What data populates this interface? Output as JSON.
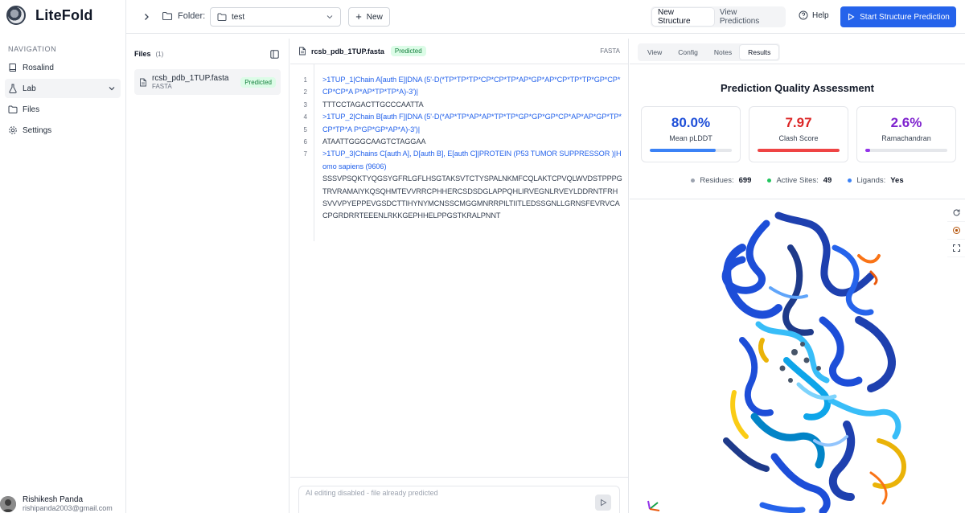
{
  "app": {
    "name": "LiteFold"
  },
  "sidebar": {
    "heading": "NAVIGATION",
    "items": [
      {
        "label": "Rosalind",
        "icon": "book-icon"
      },
      {
        "label": "Lab",
        "icon": "flask-icon",
        "active": true,
        "expandable": true
      },
      {
        "label": "Files",
        "icon": "folder-icon"
      },
      {
        "label": "Settings",
        "icon": "gear-icon"
      }
    ],
    "user": {
      "name": "Rishikesh Panda",
      "email": "rishipanda2003@gmail.com"
    }
  },
  "toolbar": {
    "folder_label": "Folder:",
    "folder_value": "test",
    "new_label": "New",
    "segments": [
      "New Structure",
      "View Predictions"
    ],
    "active_segment": "New Structure",
    "help_label": "Help",
    "start_label": "Start Structure Prediction",
    "accent_color": "#2563eb"
  },
  "files": {
    "title": "Files",
    "count": "(1)",
    "items": [
      {
        "name": "rcsb_pdb_1TUP.fasta",
        "type": "FASTA",
        "status": "Predicted"
      }
    ]
  },
  "editor": {
    "filename": "rcsb_pdb_1TUP.fasta",
    "status": "Predicted",
    "filetype": "FASTA",
    "line_numbers": [
      "1",
      "2",
      "3",
      "4",
      "5",
      "6",
      "7"
    ],
    "lines": [
      {
        "text": ">1TUP_1|Chain A[auth E]|DNA (5'-D(*TP*TP*TP*CP*CP*TP*AP*GP*AP*CP*TP*TP*GP*CP*CP*CP*A P*AP*TP*TP*A)-3')|",
        "header": true
      },
      {
        "text": "TTTCCTAGACTTGCCCAATTA",
        "header": false
      },
      {
        "text": ">1TUP_2|Chain B[auth F]|DNA (5'-D(*AP*TP*AP*AP*TP*TP*GP*GP*GP*CP*AP*AP*GP*TP*CP*TP*A P*GP*GP*AP*A)-3')|",
        "header": true
      },
      {
        "text": "ATAATTGGGCAAGTCTAGGAA",
        "header": false
      },
      {
        "text": ">1TUP_3|Chains C[auth A], D[auth B], E[auth C]|PROTEIN (P53 TUMOR SUPPRESSOR )|Homo sapiens (9606)",
        "header": true
      },
      {
        "text": "SSSVPSQKTYQGSYGFRLGFLHSGTAKSVTCTYSPALNKMFCQLAKTCPVQLWVDSTPPPGTRVRAMAIYKQSQHMTEVVRRCPHHERCSDSDGLAPPQHLIRVEGNLRVEYLDDRNTFRHSVVVPYEPPEVGSDCTTIHYNYMCNSSCMGGMNRRPILTIITLEDSSGNLLGRNSFEVRVCACPGRDRRTEEENLRKKGEPHHELPPGSTKRALPNNT",
        "header": false
      }
    ],
    "ai_placeholder": "AI editing disabled - file already predicted"
  },
  "results": {
    "tabs": [
      "View",
      "Config",
      "Notes",
      "Results"
    ],
    "active_tab": "Results",
    "title": "Prediction Quality Assessment",
    "metrics": [
      {
        "value": "80.0%",
        "label": "Mean pLDDT",
        "fraction": 0.8,
        "color": "#1d4ed8",
        "bar_color": "#3b82f6"
      },
      {
        "value": "7.97",
        "label": "Clash Score",
        "fraction": 1.0,
        "color": "#dc2626",
        "bar_color": "#ef4444"
      },
      {
        "value": "2.6%",
        "label": "Ramachandran",
        "fraction": 0.026,
        "color": "#7e22ce",
        "bar_color": "#9333ea"
      }
    ],
    "stats": [
      {
        "label": "Residues:",
        "value": "699",
        "dot": "#9ca3af"
      },
      {
        "label": "Active Sites:",
        "value": "49",
        "dot": "#22c55e"
      },
      {
        "label": "Ligands:",
        "value": "Yes",
        "dot": "#3b82f6"
      }
    ]
  }
}
